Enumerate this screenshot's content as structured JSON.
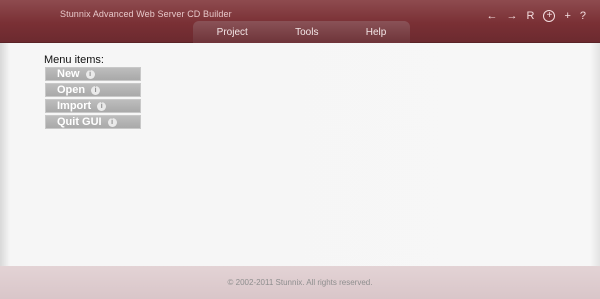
{
  "window": {
    "title": "Stunnix Advanced Web Server CD Builder",
    "controls": [
      {
        "icon": "arrow-left-icon",
        "glyph": "←"
      },
      {
        "icon": "arrow-right-icon",
        "glyph": "→"
      },
      {
        "icon": "reload-icon",
        "glyph": "R"
      },
      {
        "icon": "circle-plus-icon",
        "glyph": "+"
      },
      {
        "icon": "plus-icon",
        "glyph": "+"
      },
      {
        "icon": "help-icon",
        "glyph": "?"
      }
    ]
  },
  "nav": {
    "items": [
      "Project",
      "Tools",
      "Help"
    ]
  },
  "main": {
    "menu_label": "Menu items:",
    "menu_items": [
      "New",
      "Open",
      "Import",
      "Quit GUI"
    ]
  },
  "footer": {
    "copyright": "© 2002-2011 Stunnix. All rights reserved."
  },
  "colors": {
    "titlebar": "#7a3035",
    "nav": "#6e3439",
    "menu_button": "#b3b3b3",
    "footer": "#dfd0d2"
  }
}
